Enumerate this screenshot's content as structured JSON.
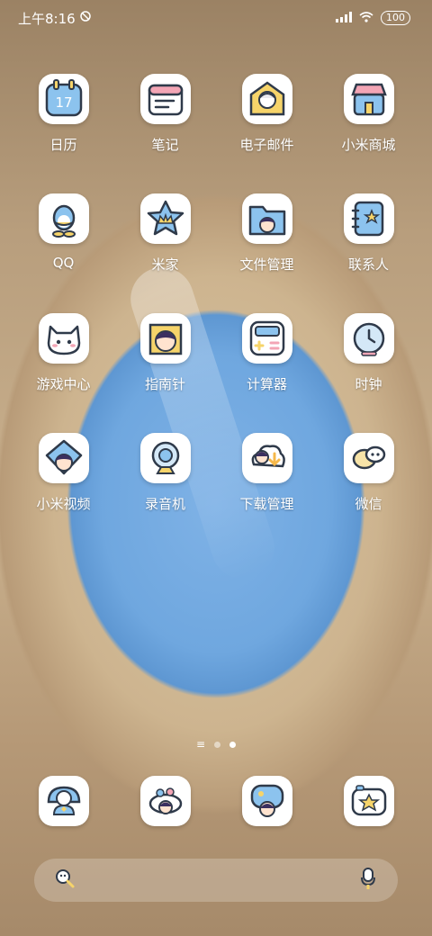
{
  "status_bar": {
    "time": "上午8:16",
    "battery": "100"
  },
  "apps": [
    {
      "label": "日历",
      "icon": "calendar-icon",
      "badge": "17"
    },
    {
      "label": "笔记",
      "icon": "notes-icon"
    },
    {
      "label": "电子邮件",
      "icon": "email-icon"
    },
    {
      "label": "小米商城",
      "icon": "store-icon"
    },
    {
      "label": "QQ",
      "icon": "qq-icon"
    },
    {
      "label": "米家",
      "icon": "mijia-icon"
    },
    {
      "label": "文件管理",
      "icon": "file-manager-icon"
    },
    {
      "label": "联系人",
      "icon": "contacts-icon"
    },
    {
      "label": "游戏中心",
      "icon": "game-center-icon"
    },
    {
      "label": "指南针",
      "icon": "compass-icon"
    },
    {
      "label": "计算器",
      "icon": "calculator-icon"
    },
    {
      "label": "时钟",
      "icon": "clock-icon"
    },
    {
      "label": "小米视频",
      "icon": "video-icon"
    },
    {
      "label": "录音机",
      "icon": "recorder-icon"
    },
    {
      "label": "下载管理",
      "icon": "download-icon"
    },
    {
      "label": "微信",
      "icon": "wechat-icon"
    }
  ],
  "dock": [
    {
      "icon": "phone-icon"
    },
    {
      "icon": "messages-icon"
    },
    {
      "icon": "browser-icon"
    },
    {
      "icon": "camera-icon"
    }
  ],
  "colors": {
    "blue": "#8cc3ee",
    "pink": "#f3a5b5",
    "yellow": "#f6d46a",
    "outline": "#2f3a4a"
  }
}
